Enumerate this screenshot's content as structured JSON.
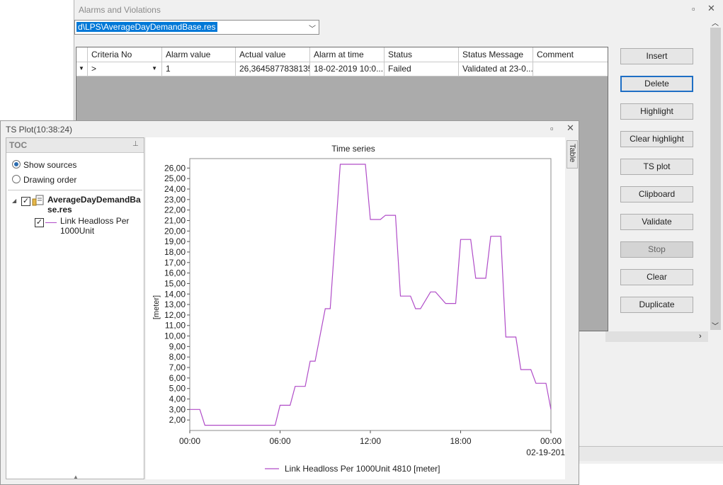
{
  "alarms_window": {
    "title": "Alarms and Violations",
    "file_path": "d\\LPS\\AverageDayDemandBase.res",
    "columns": [
      "Criteria No",
      "Alarm value",
      "Actual value",
      "Alarm at time",
      "Status",
      "Status Message",
      "Comment"
    ],
    "row": {
      "criteria": ">",
      "alarm_value": "1",
      "actual_value": "26,3645877838135",
      "alarm_time": "18-02-2019 10:0...",
      "status": "Failed",
      "status_message": "Validated at 23-0...",
      "comment": ""
    },
    "buttons": [
      "Insert",
      "Delete",
      "Highlight",
      "Clear highlight",
      "TS plot",
      "Clipboard",
      "Validate",
      "Stop",
      "Clear",
      "Duplicate"
    ]
  },
  "ts_window": {
    "title": "TS Plot(10:38:24)",
    "toc": {
      "title": "TOC",
      "show_sources": "Show sources",
      "drawing_order": "Drawing order",
      "source_line1": "AverageDayDemandBa",
      "source_line2": "se.res",
      "series_line1": "Link Headloss Per",
      "series_line2": "1000Unit"
    },
    "table_tab": "Table"
  },
  "chart_data": {
    "type": "line",
    "title": "Time series",
    "ylabel": "[meter]",
    "xlabel": "",
    "ylim": [
      1.0,
      26.9
    ],
    "xlim_hours": [
      0,
      24
    ],
    "y_ticks": [
      "2,00",
      "3,00",
      "4,00",
      "5,00",
      "6,00",
      "7,00",
      "8,00",
      "9,00",
      "10,00",
      "11,00",
      "12,00",
      "13,00",
      "14,00",
      "15,00",
      "16,00",
      "17,00",
      "18,00",
      "19,00",
      "20,00",
      "21,00",
      "22,00",
      "23,00",
      "24,00",
      "25,00",
      "26,00"
    ],
    "x_ticks": [
      "00:00",
      "06:00",
      "12:00",
      "18:00",
      "00:00"
    ],
    "x_date_label": "02-19-201",
    "colors": {
      "series": "#b04cc8"
    },
    "series": [
      {
        "name": "Link Headloss Per 1000Unit 4810 [meter]",
        "x_hours": [
          0,
          0.67,
          1,
          1.33,
          2,
          3,
          4,
          5,
          5.67,
          6,
          6.33,
          6.67,
          7,
          7.67,
          8,
          8.33,
          9,
          9.33,
          10,
          11.67,
          12,
          12.67,
          13,
          13.67,
          14,
          14.67,
          15,
          15.33,
          16,
          16.33,
          17,
          17.67,
          18,
          18.67,
          19,
          19.67,
          20,
          20.67,
          21,
          21.67,
          22,
          22.67,
          23,
          23.67,
          24
        ],
        "y": [
          3.0,
          3.0,
          1.5,
          1.5,
          1.5,
          1.5,
          1.5,
          1.5,
          1.5,
          3.4,
          3.4,
          3.4,
          5.2,
          5.2,
          7.6,
          7.6,
          12.6,
          12.6,
          26.36,
          26.36,
          21.1,
          21.1,
          21.5,
          21.5,
          13.8,
          13.8,
          12.6,
          12.6,
          14.2,
          14.2,
          13.1,
          13.1,
          19.2,
          19.2,
          15.5,
          15.5,
          19.5,
          19.5,
          9.9,
          9.9,
          6.8,
          6.8,
          5.5,
          5.5,
          3.0
        ]
      }
    ]
  }
}
